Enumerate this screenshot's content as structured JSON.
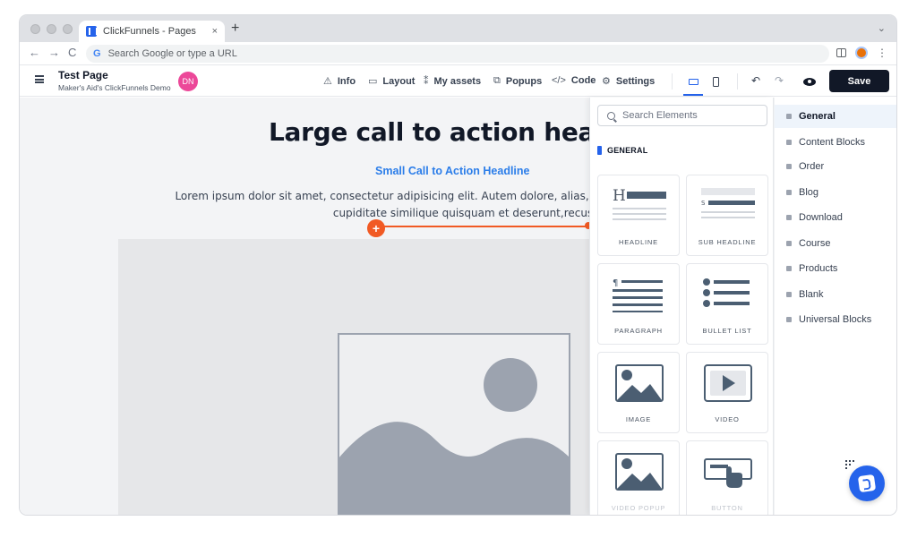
{
  "browser": {
    "tab_title": "ClickFunnels - Pages",
    "tab_close": "×",
    "new_tab": "+",
    "omnibox_placeholder": "Search Google or type a URL",
    "google_letter": "G",
    "back": "←",
    "forward": "→",
    "reload": "C",
    "tab_menu": "⌄",
    "more": "⋮"
  },
  "header": {
    "menu_icon": "hamburger-icon",
    "page_title": "Test Page",
    "page_subtitle": "Maker's Aid's ClickFunnels Demo",
    "avatar_initials": "DN",
    "avatar_color": "#ec4899",
    "nav": {
      "info": {
        "icon": "⚠",
        "label": "Info"
      },
      "layout": {
        "icon": "▭",
        "label": "Layout"
      },
      "assets": {
        "icon": "⁑",
        "label": "My assets"
      },
      "popups": {
        "icon": "⧉",
        "label": "Popups"
      },
      "code": {
        "icon": "</>",
        "label": "Code"
      },
      "settings": {
        "icon": "⚙",
        "label": "Settings"
      }
    },
    "undo": "↶",
    "redo": "↷",
    "save_label": "Save",
    "accent_color": "#2563eb"
  },
  "canvas": {
    "headline": "Large call to action head",
    "subheadline": "Small Call to Action Headline",
    "body_line1": "Lorem ipsum dolor sit amet, consectetur adipisicing elit. Autem dolore, alias,numquam enin",
    "body_line2": "cupiditate similique quisquam et deserunt,recusanda",
    "add_button": "+",
    "guide_color": "#f15a24"
  },
  "elements_panel": {
    "search_placeholder": "Search Elements",
    "section_title": "GENERAL",
    "cards": [
      {
        "label": "HEADLINE",
        "icon": "headline-icon"
      },
      {
        "label": "SUB HEADLINE",
        "icon": "sub-headline-icon"
      },
      {
        "label": "PARAGRAPH",
        "icon": "paragraph-icon"
      },
      {
        "label": "BULLET LIST",
        "icon": "bullet-list-icon"
      },
      {
        "label": "IMAGE",
        "icon": "image-icon"
      },
      {
        "label": "VIDEO",
        "icon": "video-icon"
      },
      {
        "label": "VIDEO POPUP",
        "icon": "video-popup-icon"
      },
      {
        "label": "BUTTON",
        "icon": "button-icon"
      }
    ]
  },
  "categories": [
    {
      "label": "General",
      "active": true
    },
    {
      "label": "Content Blocks",
      "active": false
    },
    {
      "label": "Order",
      "active": false
    },
    {
      "label": "Blog",
      "active": false
    },
    {
      "label": "Download",
      "active": false
    },
    {
      "label": "Course",
      "active": false
    },
    {
      "label": "Products",
      "active": false
    },
    {
      "label": "Blank",
      "active": false
    },
    {
      "label": "Universal Blocks",
      "active": false
    }
  ]
}
